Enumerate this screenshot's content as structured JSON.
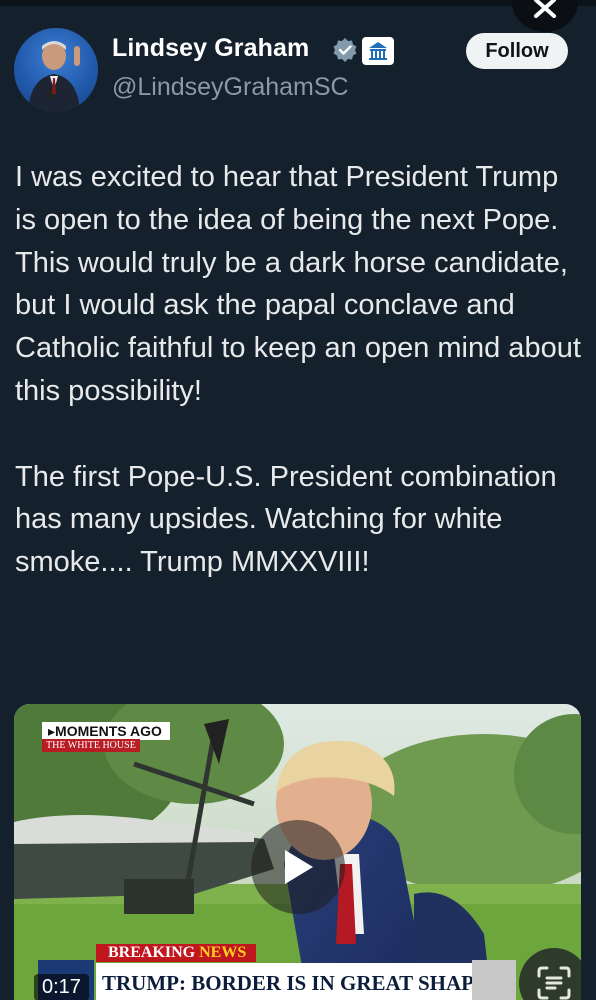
{
  "author": {
    "name": "Lindsey Graham",
    "handle": "@LindseyGrahamSC",
    "verified_icon": "verified-check-icon",
    "badge_icon": "government-building-icon"
  },
  "follow_label": "Follow",
  "close_icon": "close-icon",
  "tweet": {
    "text": "I was excited to hear that President Trump is open to the idea of being the next Pope. This would truly be a dark horse candidate, but I would ask the papal conclave and Catholic faithful to keep an open mind about this possibility!\n\nThe first Pope-U.S. President combination has many upsides. Watching for white smoke.... Trump MMXXVIII!"
  },
  "video": {
    "moments_ago": "MOMENTS AGO",
    "location_tag": "THE WHITE HOUSE",
    "breaking_word": "BREAKING",
    "news_word": "NEWS",
    "chyron": "TRUMP: BORDER IS IN GREAT SHAPE",
    "time": "0:17",
    "play_icon": "play-icon",
    "scan_icon": "text-scan-icon"
  },
  "colors": {
    "background": "#14212d",
    "handle": "#8b98a5",
    "verified": "#829aab",
    "follow_bg": "#eff3f4"
  }
}
